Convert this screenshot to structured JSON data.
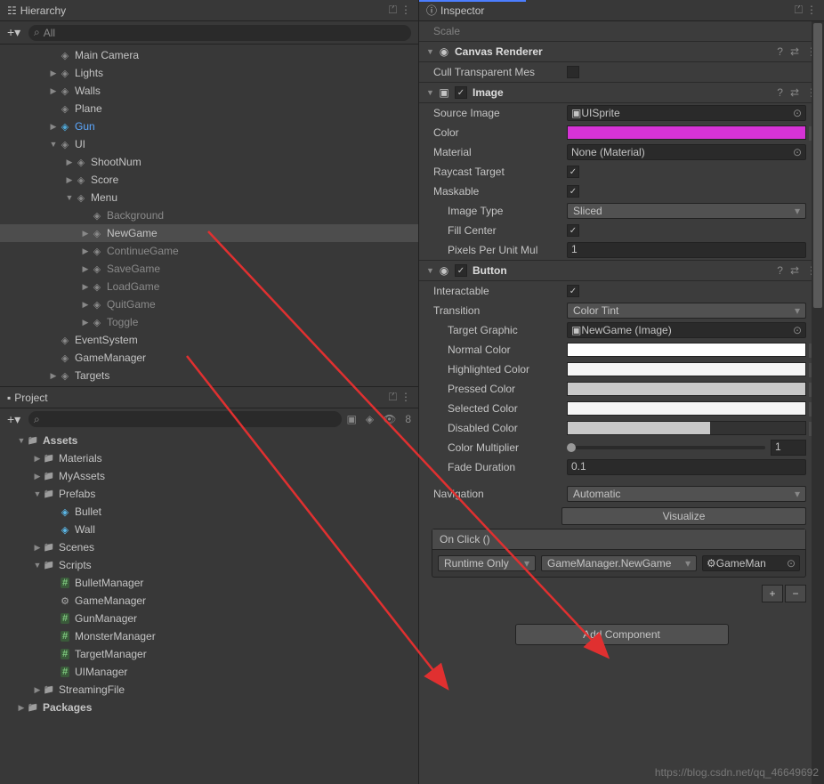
{
  "hierarchy": {
    "title": "Hierarchy",
    "search_placeholder": "All",
    "items": [
      {
        "label": "Main Camera",
        "indent": 3,
        "icon": "cube",
        "arrow": ""
      },
      {
        "label": "Lights",
        "indent": 3,
        "icon": "cube",
        "arrow": "▶"
      },
      {
        "label": "Walls",
        "indent": 3,
        "icon": "cube",
        "arrow": "▶"
      },
      {
        "label": "Plane",
        "indent": 3,
        "icon": "cube",
        "arrow": ""
      },
      {
        "label": "Gun",
        "indent": 3,
        "icon": "cube-blue",
        "arrow": "▶",
        "highlighted": true
      },
      {
        "label": "UI",
        "indent": 3,
        "icon": "cube",
        "arrow": "▼"
      },
      {
        "label": "ShootNum",
        "indent": 4,
        "icon": "cube",
        "arrow": "▶"
      },
      {
        "label": "Score",
        "indent": 4,
        "icon": "cube",
        "arrow": "▶"
      },
      {
        "label": "Menu",
        "indent": 4,
        "icon": "cube",
        "arrow": "▼"
      },
      {
        "label": "Background",
        "indent": 5,
        "icon": "cube",
        "arrow": "",
        "dim": true
      },
      {
        "label": "NewGame",
        "indent": 5,
        "icon": "cube",
        "arrow": "▶",
        "selected": true,
        "dim": true
      },
      {
        "label": "ContinueGame",
        "indent": 5,
        "icon": "cube",
        "arrow": "▶",
        "dim": true
      },
      {
        "label": "SaveGame",
        "indent": 5,
        "icon": "cube",
        "arrow": "▶",
        "dim": true
      },
      {
        "label": "LoadGame",
        "indent": 5,
        "icon": "cube",
        "arrow": "▶",
        "dim": true
      },
      {
        "label": "QuitGame",
        "indent": 5,
        "icon": "cube",
        "arrow": "▶",
        "dim": true
      },
      {
        "label": "Toggle",
        "indent": 5,
        "icon": "cube",
        "arrow": "▶",
        "dim": true
      },
      {
        "label": "EventSystem",
        "indent": 3,
        "icon": "cube",
        "arrow": ""
      },
      {
        "label": "GameManager",
        "indent": 3,
        "icon": "cube",
        "arrow": ""
      },
      {
        "label": "Targets",
        "indent": 3,
        "icon": "cube",
        "arrow": "▶"
      }
    ]
  },
  "project": {
    "title": "Project",
    "hidden_count": "8",
    "items": [
      {
        "label": "Assets",
        "indent": 1,
        "icon": "folder",
        "arrow": "▼",
        "bold": true
      },
      {
        "label": "Materials",
        "indent": 2,
        "icon": "folder",
        "arrow": "▶"
      },
      {
        "label": "MyAssets",
        "indent": 2,
        "icon": "folder",
        "arrow": "▶"
      },
      {
        "label": "Prefabs",
        "indent": 2,
        "icon": "folder",
        "arrow": "▼"
      },
      {
        "label": "Bullet",
        "indent": 3,
        "icon": "prefab",
        "arrow": ""
      },
      {
        "label": "Wall",
        "indent": 3,
        "icon": "prefab",
        "arrow": ""
      },
      {
        "label": "Scenes",
        "indent": 2,
        "icon": "folder",
        "arrow": "▶"
      },
      {
        "label": "Scripts",
        "indent": 2,
        "icon": "folder",
        "arrow": "▼"
      },
      {
        "label": "BulletManager",
        "indent": 3,
        "icon": "script",
        "arrow": ""
      },
      {
        "label": "GameManager",
        "indent": 3,
        "icon": "gear",
        "arrow": ""
      },
      {
        "label": "GunManager",
        "indent": 3,
        "icon": "script",
        "arrow": ""
      },
      {
        "label": "MonsterManager",
        "indent": 3,
        "icon": "script",
        "arrow": ""
      },
      {
        "label": "TargetManager",
        "indent": 3,
        "icon": "script",
        "arrow": ""
      },
      {
        "label": "UIManager",
        "indent": 3,
        "icon": "script",
        "arrow": ""
      },
      {
        "label": "StreamingFile",
        "indent": 2,
        "icon": "folder",
        "arrow": "▶"
      },
      {
        "label": "Packages",
        "indent": 1,
        "icon": "folder",
        "arrow": "▶",
        "bold": true
      }
    ]
  },
  "inspector": {
    "title": "Inspector",
    "scale_label": "Scale",
    "canvas_renderer": {
      "title": "Canvas Renderer",
      "cull_transparent": "Cull Transparent Mes"
    },
    "image": {
      "title": "Image",
      "source_image_label": "Source Image",
      "source_image_value": "UISprite",
      "color_label": "Color",
      "color_value": "#d633d6",
      "material_label": "Material",
      "material_value": "None (Material)",
      "raycast_label": "Raycast Target",
      "maskable_label": "Maskable",
      "image_type_label": "Image Type",
      "image_type_value": "Sliced",
      "fill_center_label": "Fill Center",
      "ppu_label": "Pixels Per Unit Mul",
      "ppu_value": "1"
    },
    "button": {
      "title": "Button",
      "interactable_label": "Interactable",
      "transition_label": "Transition",
      "transition_value": "Color Tint",
      "target_graphic_label": "Target Graphic",
      "target_graphic_value": "NewGame (Image)",
      "normal_color_label": "Normal Color",
      "normal_color": "#ffffff",
      "highlighted_color_label": "Highlighted Color",
      "highlighted_color": "#f5f5f5",
      "pressed_color_label": "Pressed Color",
      "pressed_color": "#c8c8c8",
      "selected_color_label": "Selected Color",
      "selected_color": "#f5f5f5",
      "disabled_color_label": "Disabled Color",
      "color_multiplier_label": "Color Multiplier",
      "color_multiplier_value": "1",
      "fade_duration_label": "Fade Duration",
      "fade_duration_value": "0.1",
      "navigation_label": "Navigation",
      "navigation_value": "Automatic",
      "visualize_label": "Visualize",
      "onclick_title": "On Click ()",
      "runtime_only": "Runtime Only",
      "callback": "GameManager.NewGame",
      "object_ref": "GameMan"
    },
    "add_component": "Add Component"
  },
  "watermark": "https://blog.csdn.net/qq_46649692"
}
